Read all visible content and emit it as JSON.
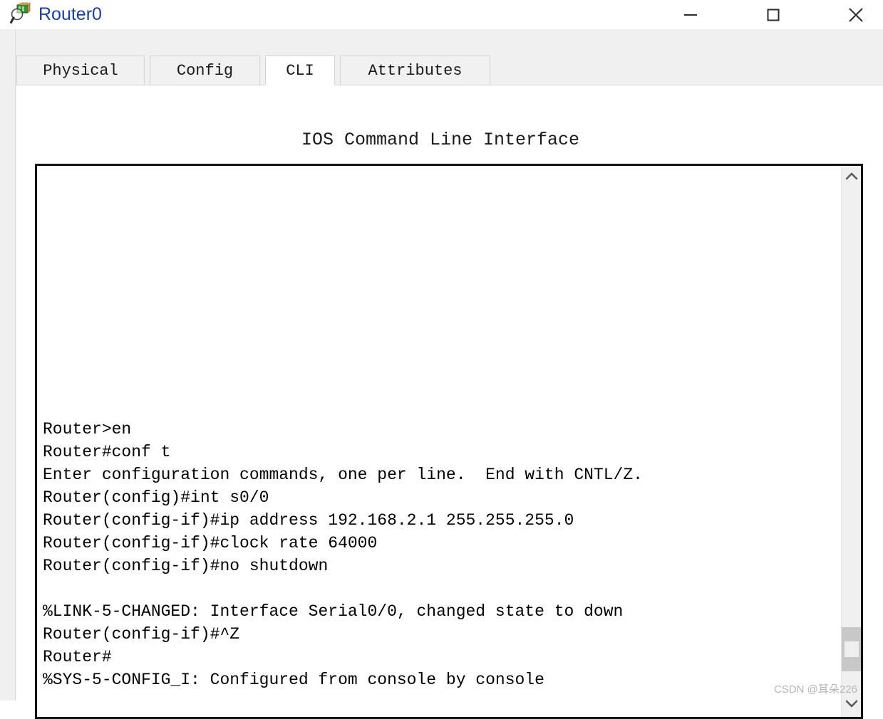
{
  "window": {
    "title": "Router0",
    "icon": "router-magnifier-icon",
    "title_color": "#1b3f9c",
    "controls": [
      {
        "name": "minimize",
        "glyph": "—"
      },
      {
        "name": "maximize",
        "glyph": "□"
      },
      {
        "name": "close",
        "glyph": "✕"
      }
    ]
  },
  "tabs": [
    {
      "label": "Physical",
      "active": false
    },
    {
      "label": "Config",
      "active": false
    },
    {
      "label": "CLI",
      "active": true
    },
    {
      "label": "Attributes",
      "active": false
    }
  ],
  "panel": {
    "title": "IOS Command Line Interface"
  },
  "terminal": {
    "lines": [
      "Router>en",
      "Router#conf t",
      "Enter configuration commands, one per line.  End with CNTL/Z.",
      "Router(config)#int s0/0",
      "Router(config-if)#ip address 192.168.2.1 255.255.255.0",
      "Router(config-if)#clock rate 64000",
      "Router(config-if)#no shutdown",
      "",
      "%LINK-5-CHANGED: Interface Serial0/0, changed state to down",
      "Router(config-if)#^Z",
      "Router#",
      "%SYS-5-CONFIG_I: Configured from console by console",
      ""
    ],
    "text_color": "#000000",
    "background": "#ffffff",
    "border_color": "#111111"
  },
  "scrollbar": {
    "up_glyph": "∧",
    "down_glyph": "∨",
    "thumb_color": "#c8c8c8",
    "track_color": "#f0f0f0"
  },
  "watermark": {
    "text": "CSDN @耳朵226"
  }
}
